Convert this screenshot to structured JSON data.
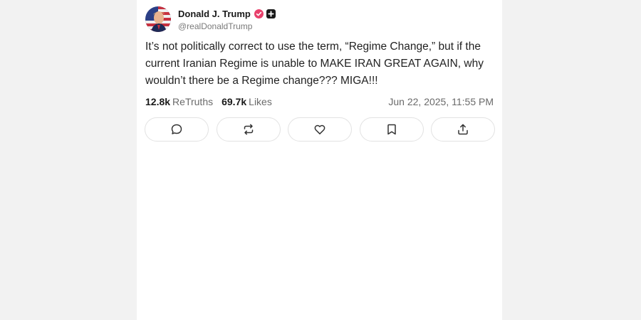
{
  "post": {
    "author": {
      "display_name": "Donald J. Trump",
      "handle": "@realDonaldTrump",
      "verified_icon": "verified-badge-icon",
      "badge_icon": "plus-badge-icon"
    },
    "text": "It’s not politically correct to use the term, “Regime Change,” but if the current Iranian Regime is unable to MAKE IRAN GREAT AGAIN, why wouldn’t there be a Regime change??? MIGA!!!",
    "stats": {
      "retruths_count": "12.8k",
      "retruths_label": "ReTruths",
      "likes_count": "69.7k",
      "likes_label": "Likes"
    },
    "timestamp": "Jun 22, 2025, 11:55 PM",
    "actions": [
      {
        "icon": "reply-icon"
      },
      {
        "icon": "retruth-icon"
      },
      {
        "icon": "like-icon"
      },
      {
        "icon": "bookmark-icon"
      },
      {
        "icon": "share-icon"
      }
    ]
  },
  "colors": {
    "background": "#f2f2f2",
    "card": "#ffffff",
    "verified_badge": "#e8406b",
    "text": "#222222",
    "muted": "#6a6a6a"
  }
}
